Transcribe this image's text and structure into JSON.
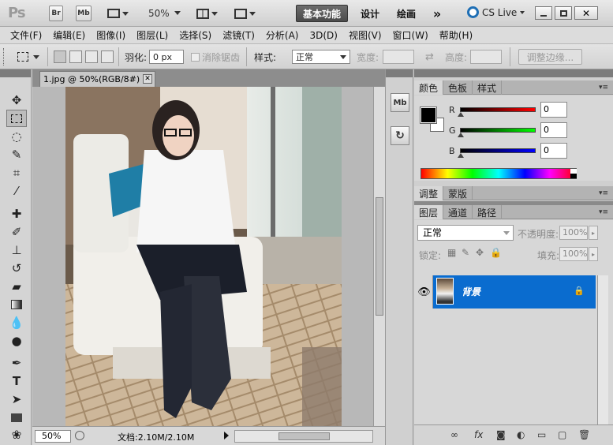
{
  "app": {
    "logo": "Ps",
    "bridge_btn": "Br",
    "minibridge_btn": "Mb",
    "zoom": "50%",
    "workspaces": [
      "基本功能",
      "设计",
      "绘画"
    ],
    "more": "»",
    "cs_live": "CS Live",
    "window_controls": [
      "minimize",
      "maximize",
      "close"
    ]
  },
  "menu": [
    "文件(F)",
    "编辑(E)",
    "图像(I)",
    "图层(L)",
    "选择(S)",
    "滤镜(T)",
    "分析(A)",
    "3D(D)",
    "视图(V)",
    "窗口(W)",
    "帮助(H)"
  ],
  "options": {
    "feather_label": "羽化:",
    "feather_value": "0 px",
    "antialias_label": "消除锯齿",
    "style_label": "样式:",
    "style_value": "正常",
    "width_label": "宽度:",
    "height_label": "高度:",
    "refine_edge": "调整边缘..."
  },
  "document": {
    "tab_title": "1.jpg @ 50%(RGB/8#)",
    "zoom": "50%",
    "doc_info": "文档:2.10M/2.10M"
  },
  "panels": {
    "color_tabs": [
      "颜色",
      "色板",
      "样式"
    ],
    "color": {
      "r_label": "R",
      "r_value": "0",
      "g_label": "G",
      "g_value": "0",
      "b_label": "B",
      "b_value": "0",
      "foreground": "#000000",
      "background": "#ffffff"
    },
    "adjust_tabs": [
      "调整",
      "蒙版"
    ],
    "layer_tabs": [
      "图层",
      "通道",
      "路径"
    ],
    "layers": {
      "blend_mode": "正常",
      "opacity_label": "不透明度:",
      "opacity_value": "100%",
      "lock_label": "锁定:",
      "fill_label": "填充:",
      "fill_value": "100%",
      "items": [
        {
          "name": "背景"
        }
      ]
    }
  },
  "colors": {
    "selection_blue": "#0a6ccf",
    "chrome_gray": "#cfcfcf"
  }
}
